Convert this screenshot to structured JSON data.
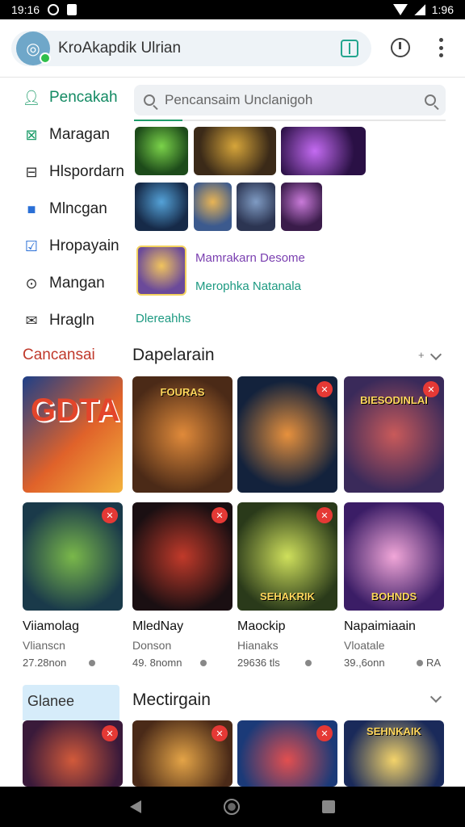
{
  "status_bar": {
    "time": "19:16",
    "right_time": "1:96"
  },
  "browser": {
    "url_text": "KroAkapdik Ulrian",
    "icons": [
      "tabs-icon",
      "history-icon",
      "more-vert-icon"
    ]
  },
  "sidebar": {
    "items": [
      {
        "label": "Pencakah",
        "icon": "person-icon",
        "active": true
      },
      {
        "label": "Maragan",
        "icon": "inbox-icon"
      },
      {
        "label": "Hlspordarn",
        "icon": "square-icon"
      },
      {
        "label": "Mlncgan",
        "icon": "box-icon"
      },
      {
        "label": "Hropayain",
        "icon": "check-box-icon"
      },
      {
        "label": "Mangan",
        "icon": "circle-icon"
      },
      {
        "label": "Hragln",
        "icon": "envelope-icon"
      }
    ],
    "section_label": "Cancansai"
  },
  "search": {
    "placeholder": "Pencansaim Unclanigoh"
  },
  "recent": {
    "line1": "Mamrakarn Desome",
    "line2": "Merophka Natanala",
    "link": "Dlereahhs"
  },
  "section1": {
    "title": "Dapelarain",
    "sort": "+"
  },
  "games_row1": [
    {
      "caption": "GDTA"
    },
    {
      "caption": "FOURAS"
    },
    {
      "caption": ""
    },
    {
      "caption": "BIESODINLAI"
    }
  ],
  "games_row2": [
    {
      "caption": "",
      "title": "Viiamolag",
      "sub": "Vlianscn",
      "meta": "27.28non"
    },
    {
      "caption": "",
      "title": "MledNay",
      "sub": "Donson",
      "meta": "49. 8nomn"
    },
    {
      "caption": "SEHAKRIK",
      "title": "Maockip",
      "sub": "Hianaks",
      "meta": "29636 tls"
    },
    {
      "caption": "BOHNDS",
      "title": "Napaimiaain",
      "sub": "Vloatale",
      "meta": "39.,6onn",
      "extra": "RA"
    }
  ],
  "section2": {
    "chip": "Glanee",
    "title": "Mectirgain"
  },
  "games_row3": [
    {
      "caption": ""
    },
    {
      "caption": ""
    },
    {
      "caption": ""
    },
    {
      "caption": "SEHNKAIK"
    }
  ]
}
